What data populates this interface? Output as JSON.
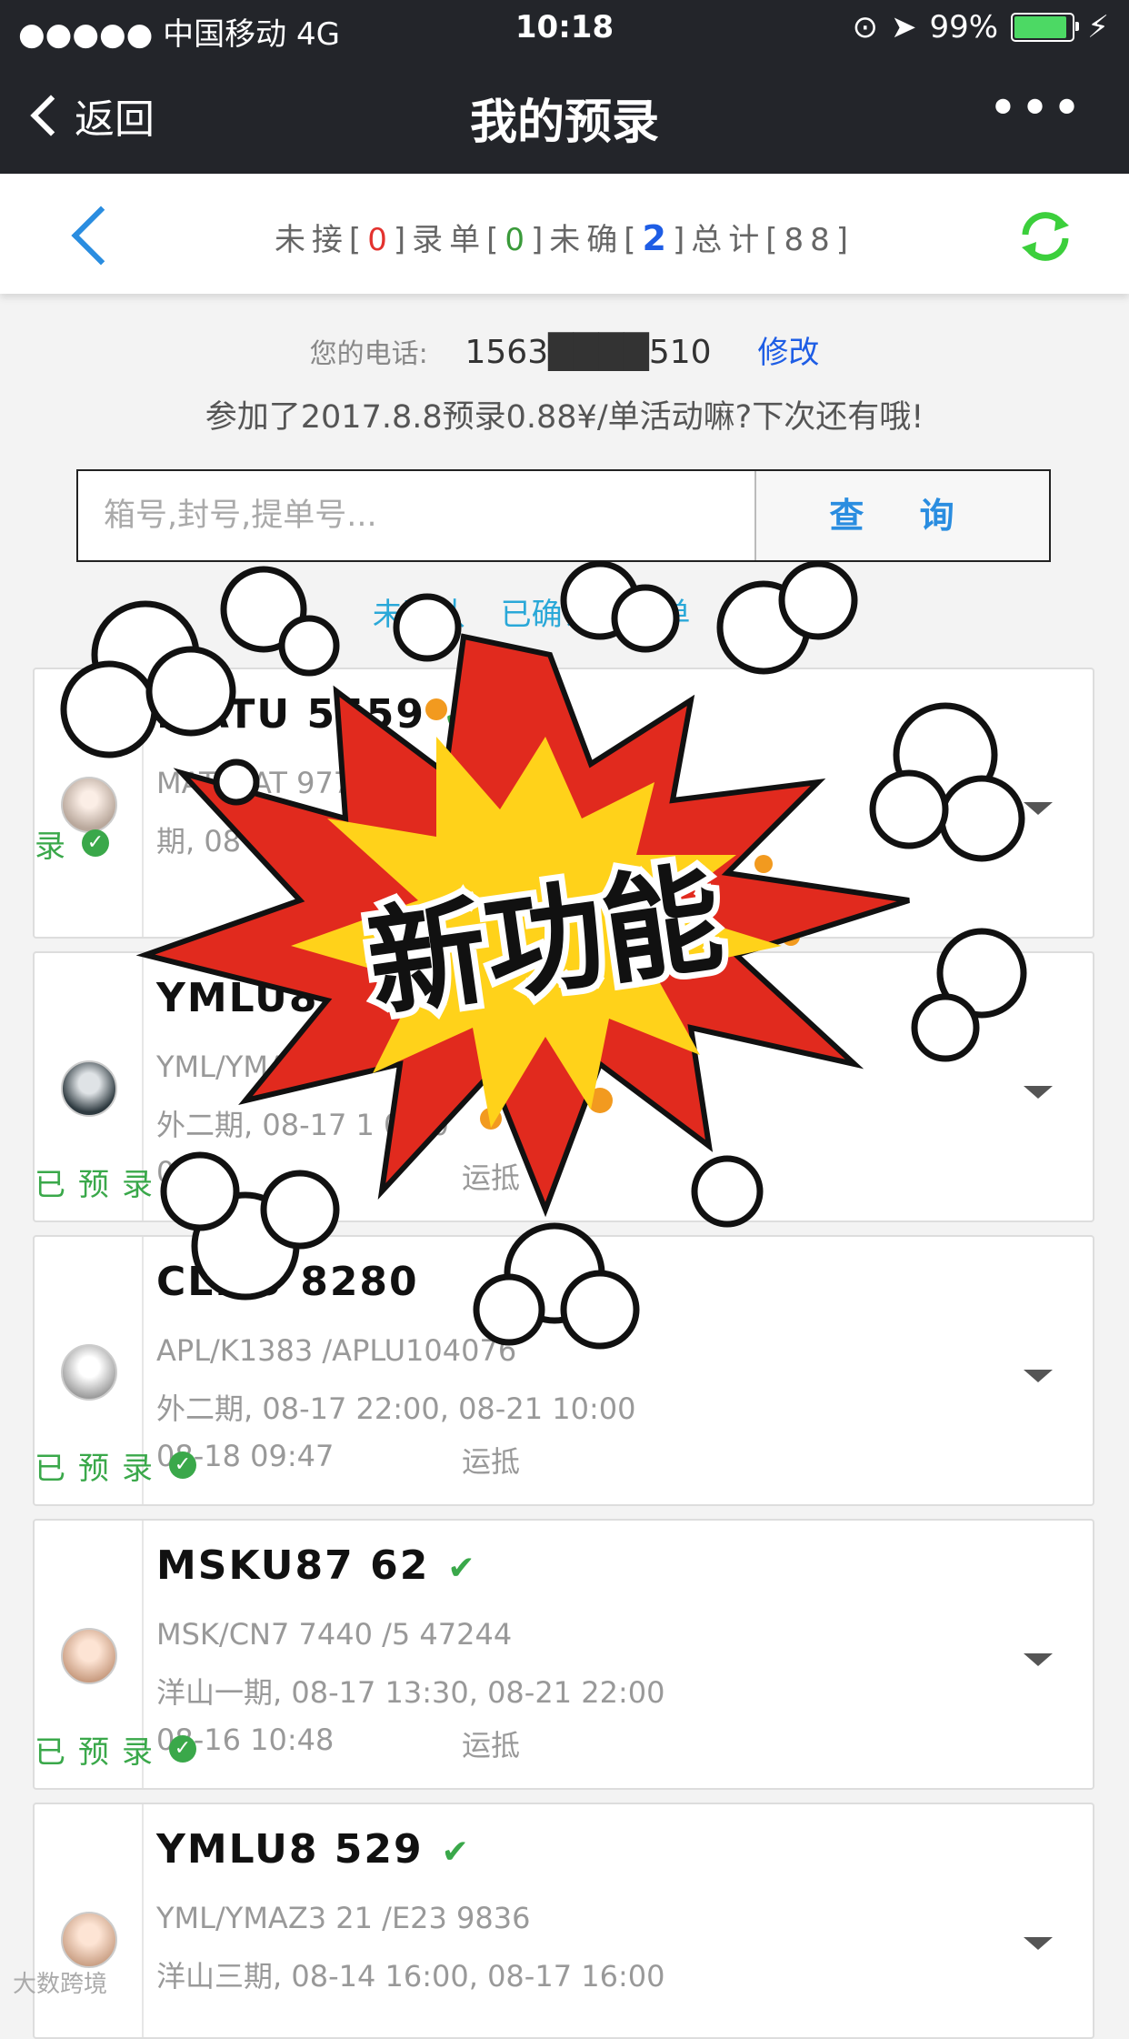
{
  "status_bar": {
    "carrier": "●●●●● 中国移动   4G",
    "time": "10:18",
    "battery": "99%",
    "battery_level": 0.99
  },
  "nav": {
    "back_label": "返回",
    "title": "我的预录",
    "more_label": "•••"
  },
  "summary": {
    "p1": "未接[",
    "unreceived": "0",
    "p2": "]录单[",
    "entered": "0",
    "p3": "]未确[",
    "unconfirmed": "2",
    "p4": "]总计[88]"
  },
  "phone": {
    "label": "您的电话:",
    "number": "1563",
    "number_tail": "510",
    "edit_label": "修改"
  },
  "promo_text": "参加了2017.8.8预录0.88¥/单活动嘛?下次还有哦!",
  "search": {
    "placeholder": "箱号,封号,提单号...",
    "button_label": "查 询"
  },
  "filters": [
    "未确认",
    "已确认",
    "打单",
    "录"
  ],
  "burst_label": "新功能",
  "cards": [
    {
      "container_id": "MATU   5559",
      "line2": "MAT/MAT   977 /M     00",
      "line3": "   期, 08",
      "line4": "",
      "mode": "",
      "status": "录"
    },
    {
      "container_id": "YMLU8",
      "line2": "YML/YMA   04",
      "line3": "外二期, 08-17 1      0:00",
      "line4": "08-",
      "mode": "运抵",
      "status": "已预录"
    },
    {
      "container_id": "CLHU    8280",
      "line2": "APL/K1383     /APLU104076",
      "line3": "外二期, 08-17 22:00, 08-21 10:00",
      "line4": "08-18 09:47",
      "mode": "运抵",
      "status": "已预录"
    },
    {
      "container_id": "MSKU87    62",
      "line2": "MSK/CN7   7440 /5    47244",
      "line3": "洋山一期, 08-17 13:30, 08-21 22:00",
      "line4": "08-16 10:48",
      "mode": "运抵",
      "status": "已预录"
    },
    {
      "container_id": "YMLU8    529",
      "line2": "YML/YMAZ3    21 /E23    9836",
      "line3": "洋山三期, 08-14 16:00, 08-17 16:00",
      "line4": "",
      "mode": "",
      "status": ""
    }
  ],
  "watermark": "大数跨境",
  "colors": {
    "nav_bg": "#23252a",
    "accent_blue": "#2a8de0",
    "confirmed_green": "#3aa84a",
    "refresh_green": "#3ccf3c",
    "count_red": "#e3322e"
  }
}
